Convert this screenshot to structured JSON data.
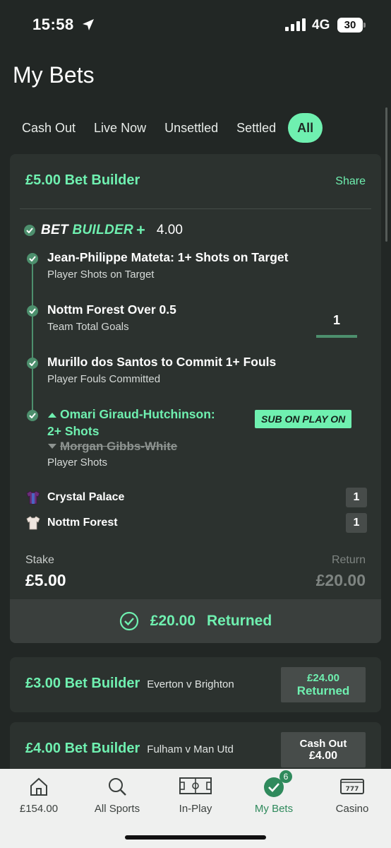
{
  "status_bar": {
    "time": "15:58",
    "network": "4G",
    "battery": "30"
  },
  "page_title": "My Bets",
  "tabs": [
    {
      "label": "Cash Out"
    },
    {
      "label": "Live Now"
    },
    {
      "label": "Unsettled"
    },
    {
      "label": "Settled"
    },
    {
      "label": "All"
    }
  ],
  "main_bet": {
    "title": "£5.00 Bet Builder",
    "share_label": "Share",
    "builder_bet": "BET",
    "builder_word": "BUILDER",
    "builder_plus": "+",
    "odds": "4.00",
    "legs": [
      {
        "title": "Jean-Philippe Mateta: 1+ Shots on Target",
        "subtitle": "Player Shots on Target"
      },
      {
        "title": "Nottm Forest Over 0.5",
        "subtitle": "Team Total Goals",
        "tracker_value": "1"
      },
      {
        "title": "Murillo dos Santos to Commit 1+ Fouls",
        "subtitle": "Player Fouls Committed"
      },
      {
        "title_line1": "Omari Giraud-Hutchinson:",
        "title_line2": "2+ Shots",
        "replaced_player": "Morgan Gibbs-White",
        "subtitle": "Player Shots",
        "badge": "SUB ON PLAY ON"
      }
    ],
    "teams": [
      {
        "name": "Crystal Palace",
        "score": "1",
        "shirt_color": "#6b2d7a"
      },
      {
        "name": "Nottm Forest",
        "score": "1",
        "shirt_color": "#efe6df"
      }
    ],
    "stake_label": "Stake",
    "stake_value": "£5.00",
    "return_label": "Return",
    "return_value": "£20.00",
    "returned_amount": "£20.00",
    "returned_label": "Returned"
  },
  "other_bets": [
    {
      "title": "£3.00 Bet Builder",
      "match": "Everton v Brighton",
      "status_line1": "£24.00",
      "status_line2": "Returned"
    },
    {
      "title": "£4.00 Bet Builder",
      "match": "Fulham v Man Utd",
      "status_line1": "Cash Out",
      "status_line2": "£4.00"
    }
  ],
  "bottom_nav": [
    {
      "label": "£154.00",
      "icon": "home-icon"
    },
    {
      "label": "All Sports",
      "icon": "search-icon"
    },
    {
      "label": "In-Play",
      "icon": "pitch-icon"
    },
    {
      "label": "My Bets",
      "icon": "check-circle-icon",
      "badge": "6"
    },
    {
      "label": "Casino",
      "icon": "slot-machine-icon"
    }
  ],
  "colors": {
    "accent": "#6ff0b0",
    "background": "#222725",
    "card": "#2c322f",
    "nav_active": "#2f8a5c"
  }
}
